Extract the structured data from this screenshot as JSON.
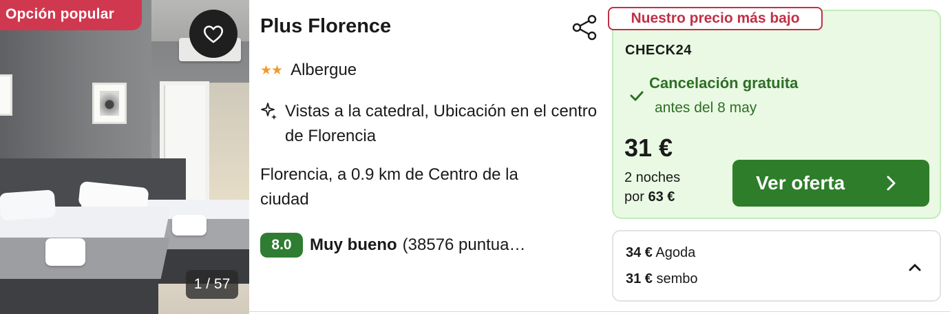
{
  "photo": {
    "badge": "Opción popular",
    "counter": "1 / 57",
    "favorite_icon": "heart-outline-icon"
  },
  "hotel": {
    "name": "Plus Florence",
    "stars": "★★",
    "type": "Albergue",
    "highlights": "Vistas a la catedral, Ubicación en el centro de Florencia",
    "location": "Florencia, a 0.9 km de Centro de la ciudad",
    "rating_score": "8.0",
    "rating_label": "Muy bueno",
    "rating_count": "(38576 puntua…"
  },
  "deal": {
    "tag": "Nuestro precio más bajo",
    "provider": "CHECK24",
    "cancel_title": "Cancelación gratuita",
    "cancel_sub": "antes del 8 may",
    "price": "31 €",
    "nights_line1": "2 noches",
    "nights_prefix": "por",
    "nights_total": "63 €",
    "cta": "Ver oferta"
  },
  "other_offers": [
    {
      "price": "34 €",
      "provider": "Agoda"
    },
    {
      "price": "31 €",
      "provider": "sembo"
    }
  ],
  "colors": {
    "popular_badge": "#d0384f",
    "accent_green": "#2e7d2a",
    "deal_bg": "#e9f9e3",
    "lowest_tag": "#c03046",
    "star": "#f09a2e"
  }
}
